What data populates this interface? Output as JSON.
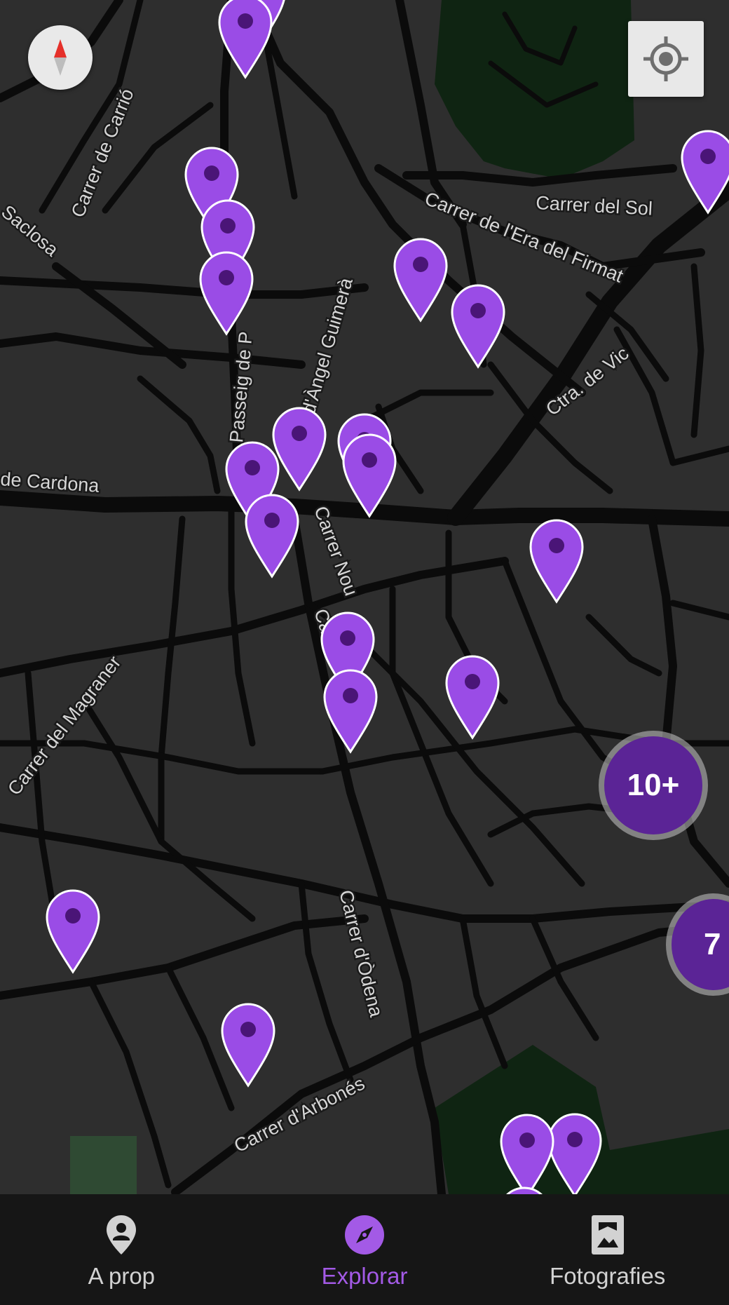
{
  "colors": {
    "map_background": "#2e2e2e",
    "roads": "#0b0b0b",
    "park": "#0f2412",
    "marker_fill": "#9a4ce6",
    "marker_dot": "#4a1577",
    "cluster_fill": "#5b2496",
    "nav_background": "#161616",
    "nav_active": "#a35ae6",
    "nav_inactive": "#d2d2d2"
  },
  "map": {
    "street_labels": [
      "Carrer de Carrió",
      "Saclosa",
      "Carrer del Sol",
      "Carrer de l'Era del Firmat",
      "Ctra. de Vic",
      "Passeig de P",
      "d'Àngel Guimerà",
      "de Cardona",
      "Carrer Nou",
      "Carrer",
      "Carrer del Magraner",
      "Carrer d'Òdena",
      "Carrer d'Arbonés"
    ],
    "clusters": [
      {
        "count": "10+"
      },
      {
        "count": "7"
      }
    ],
    "controls": {
      "compass_icon": "compass-icon",
      "locate_icon": "my-location-icon"
    }
  },
  "nav": {
    "items": [
      {
        "label": "A prop",
        "icon": "person-pin-icon",
        "active": false
      },
      {
        "label": "Explorar",
        "icon": "explore-icon",
        "active": true
      },
      {
        "label": "Fotografies",
        "icon": "photo-icon",
        "active": false
      }
    ]
  }
}
